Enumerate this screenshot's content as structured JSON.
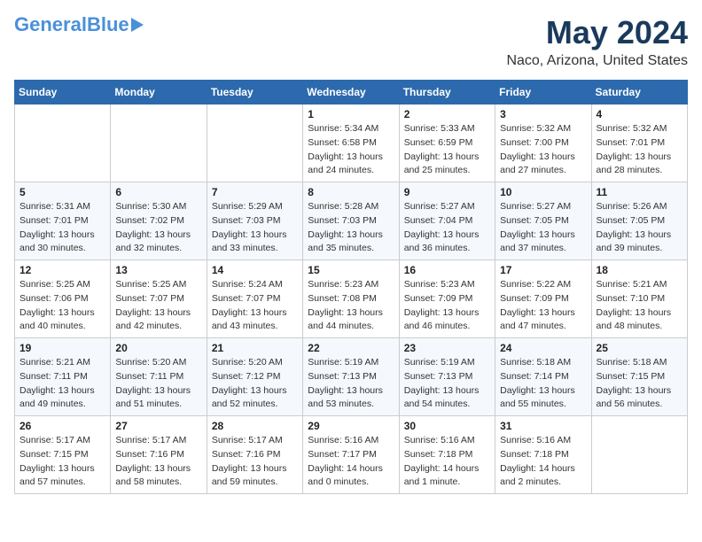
{
  "header": {
    "logo_line1": "General",
    "logo_line2": "Blue",
    "main_title": "May 2024",
    "subtitle": "Naco, Arizona, United States"
  },
  "calendar": {
    "days_of_week": [
      "Sunday",
      "Monday",
      "Tuesday",
      "Wednesday",
      "Thursday",
      "Friday",
      "Saturday"
    ],
    "weeks": [
      [
        {
          "day": "",
          "info": ""
        },
        {
          "day": "",
          "info": ""
        },
        {
          "day": "",
          "info": ""
        },
        {
          "day": "1",
          "info": "Sunrise: 5:34 AM\nSunset: 6:58 PM\nDaylight: 13 hours and 24 minutes."
        },
        {
          "day": "2",
          "info": "Sunrise: 5:33 AM\nSunset: 6:59 PM\nDaylight: 13 hours and 25 minutes."
        },
        {
          "day": "3",
          "info": "Sunrise: 5:32 AM\nSunset: 7:00 PM\nDaylight: 13 hours and 27 minutes."
        },
        {
          "day": "4",
          "info": "Sunrise: 5:32 AM\nSunset: 7:01 PM\nDaylight: 13 hours and 28 minutes."
        }
      ],
      [
        {
          "day": "5",
          "info": "Sunrise: 5:31 AM\nSunset: 7:01 PM\nDaylight: 13 hours and 30 minutes."
        },
        {
          "day": "6",
          "info": "Sunrise: 5:30 AM\nSunset: 7:02 PM\nDaylight: 13 hours and 32 minutes."
        },
        {
          "day": "7",
          "info": "Sunrise: 5:29 AM\nSunset: 7:03 PM\nDaylight: 13 hours and 33 minutes."
        },
        {
          "day": "8",
          "info": "Sunrise: 5:28 AM\nSunset: 7:03 PM\nDaylight: 13 hours and 35 minutes."
        },
        {
          "day": "9",
          "info": "Sunrise: 5:27 AM\nSunset: 7:04 PM\nDaylight: 13 hours and 36 minutes."
        },
        {
          "day": "10",
          "info": "Sunrise: 5:27 AM\nSunset: 7:05 PM\nDaylight: 13 hours and 37 minutes."
        },
        {
          "day": "11",
          "info": "Sunrise: 5:26 AM\nSunset: 7:05 PM\nDaylight: 13 hours and 39 minutes."
        }
      ],
      [
        {
          "day": "12",
          "info": "Sunrise: 5:25 AM\nSunset: 7:06 PM\nDaylight: 13 hours and 40 minutes."
        },
        {
          "day": "13",
          "info": "Sunrise: 5:25 AM\nSunset: 7:07 PM\nDaylight: 13 hours and 42 minutes."
        },
        {
          "day": "14",
          "info": "Sunrise: 5:24 AM\nSunset: 7:07 PM\nDaylight: 13 hours and 43 minutes."
        },
        {
          "day": "15",
          "info": "Sunrise: 5:23 AM\nSunset: 7:08 PM\nDaylight: 13 hours and 44 minutes."
        },
        {
          "day": "16",
          "info": "Sunrise: 5:23 AM\nSunset: 7:09 PM\nDaylight: 13 hours and 46 minutes."
        },
        {
          "day": "17",
          "info": "Sunrise: 5:22 AM\nSunset: 7:09 PM\nDaylight: 13 hours and 47 minutes."
        },
        {
          "day": "18",
          "info": "Sunrise: 5:21 AM\nSunset: 7:10 PM\nDaylight: 13 hours and 48 minutes."
        }
      ],
      [
        {
          "day": "19",
          "info": "Sunrise: 5:21 AM\nSunset: 7:11 PM\nDaylight: 13 hours and 49 minutes."
        },
        {
          "day": "20",
          "info": "Sunrise: 5:20 AM\nSunset: 7:11 PM\nDaylight: 13 hours and 51 minutes."
        },
        {
          "day": "21",
          "info": "Sunrise: 5:20 AM\nSunset: 7:12 PM\nDaylight: 13 hours and 52 minutes."
        },
        {
          "day": "22",
          "info": "Sunrise: 5:19 AM\nSunset: 7:13 PM\nDaylight: 13 hours and 53 minutes."
        },
        {
          "day": "23",
          "info": "Sunrise: 5:19 AM\nSunset: 7:13 PM\nDaylight: 13 hours and 54 minutes."
        },
        {
          "day": "24",
          "info": "Sunrise: 5:18 AM\nSunset: 7:14 PM\nDaylight: 13 hours and 55 minutes."
        },
        {
          "day": "25",
          "info": "Sunrise: 5:18 AM\nSunset: 7:15 PM\nDaylight: 13 hours and 56 minutes."
        }
      ],
      [
        {
          "day": "26",
          "info": "Sunrise: 5:17 AM\nSunset: 7:15 PM\nDaylight: 13 hours and 57 minutes."
        },
        {
          "day": "27",
          "info": "Sunrise: 5:17 AM\nSunset: 7:16 PM\nDaylight: 13 hours and 58 minutes."
        },
        {
          "day": "28",
          "info": "Sunrise: 5:17 AM\nSunset: 7:16 PM\nDaylight: 13 hours and 59 minutes."
        },
        {
          "day": "29",
          "info": "Sunrise: 5:16 AM\nSunset: 7:17 PM\nDaylight: 14 hours and 0 minutes."
        },
        {
          "day": "30",
          "info": "Sunrise: 5:16 AM\nSunset: 7:18 PM\nDaylight: 14 hours and 1 minute."
        },
        {
          "day": "31",
          "info": "Sunrise: 5:16 AM\nSunset: 7:18 PM\nDaylight: 14 hours and 2 minutes."
        },
        {
          "day": "",
          "info": ""
        }
      ]
    ]
  }
}
